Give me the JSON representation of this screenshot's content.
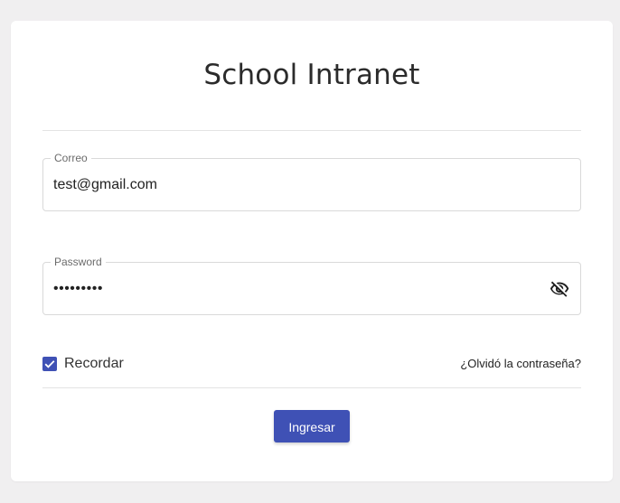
{
  "page": {
    "title": "School Intranet"
  },
  "form": {
    "email": {
      "label": "Correo",
      "value": "test@gmail.com"
    },
    "password": {
      "label": "Password",
      "value": "•••••••••",
      "visibility_icon": "eye-off-icon"
    },
    "remember": {
      "label": "Recordar",
      "checked": true
    },
    "forgot_link": "¿Olvidó la contraseña?",
    "submit_label": "Ingresar"
  },
  "colors": {
    "accent": "#3f51b5",
    "background": "#f0eff0",
    "card": "#ffffff"
  }
}
